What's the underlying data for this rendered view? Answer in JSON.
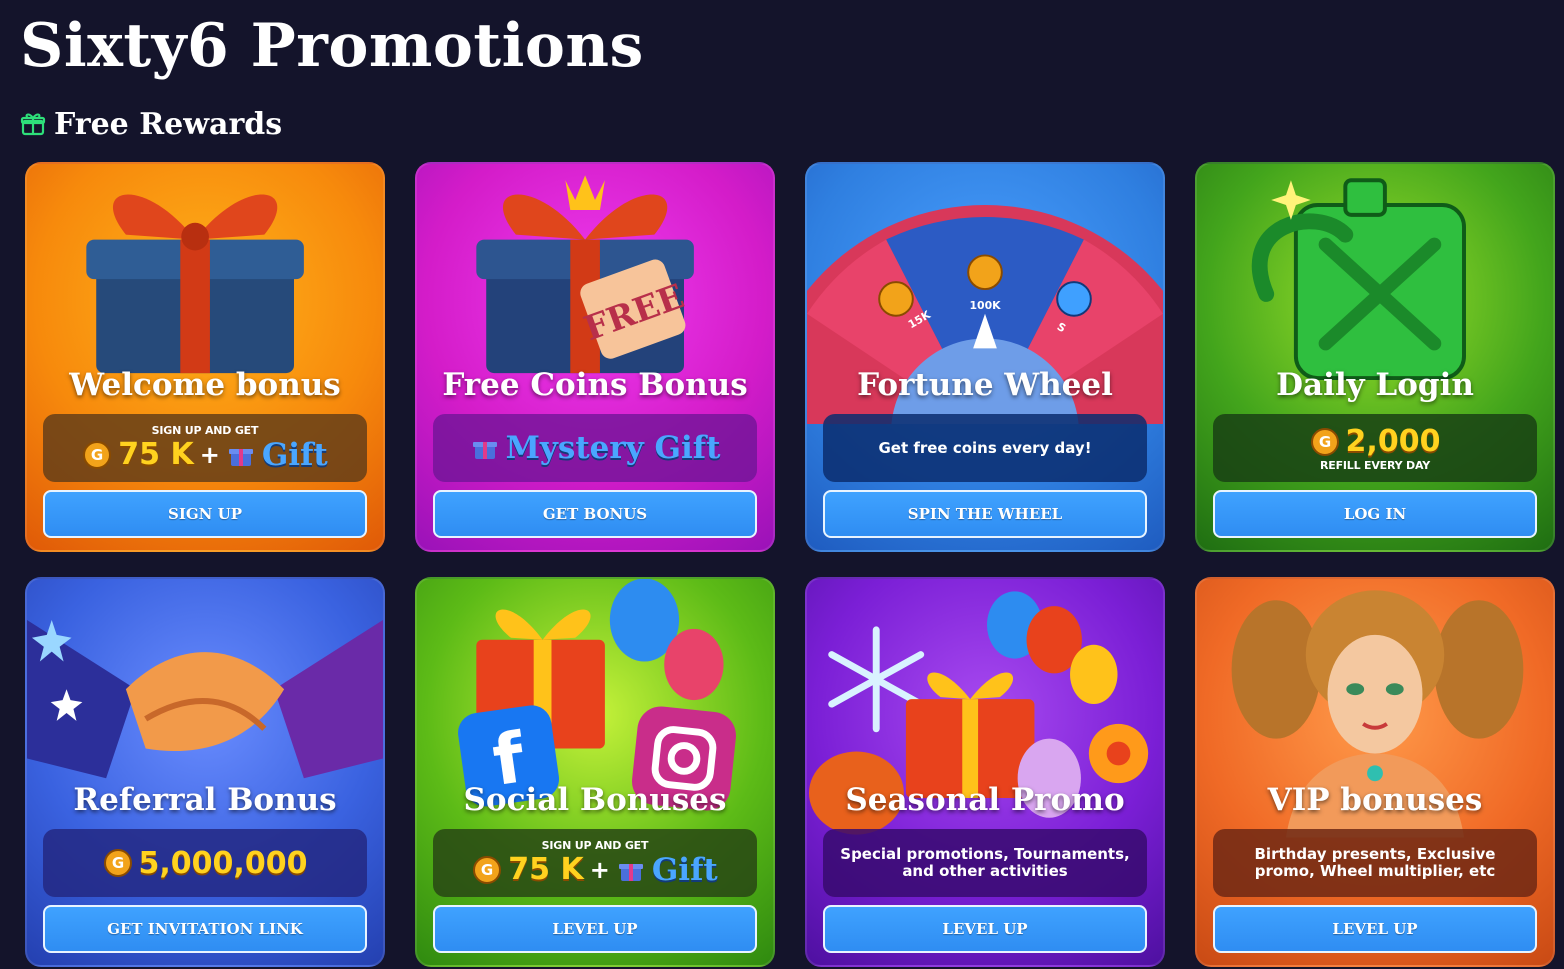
{
  "page": {
    "title": "Sixty6 Promotions",
    "section_title": "Free Rewards"
  },
  "cards": [
    {
      "id": "welcome",
      "title": "Welcome bonus",
      "caption": "SIGN UP AND GET",
      "amount": "75 K",
      "plus": "+",
      "gift": "Gift",
      "button": "SIGN UP",
      "bg": "#f78a0c"
    },
    {
      "id": "free-coins",
      "title": "Free Coins Bonus",
      "gift_label": "Mystery Gift",
      "button": "GET BONUS",
      "bg": "#d41cc9"
    },
    {
      "id": "fortune-wheel",
      "title": "Fortune Wheel",
      "text": "Get free coins every day!",
      "button": "SPIN THE WHEEL",
      "bg": "#2f7fe0",
      "wheel_labels": [
        "15K",
        "100K",
        "S"
      ]
    },
    {
      "id": "daily-login",
      "title": "Daily Login",
      "amount": "2,000",
      "caption": "REFILL EVERY DAY",
      "button": "LOG IN",
      "bg": "#43a51c"
    },
    {
      "id": "referral",
      "title": "Referral Bonus",
      "amount": "5,000,000",
      "button": "GET INVITATION LINK",
      "bg": "#3a62e0"
    },
    {
      "id": "social",
      "title": "Social Bonuses",
      "caption": "SIGN UP AND GET",
      "amount": "75 K",
      "plus": "+",
      "gift": "Gift",
      "button": "LEVEL UP",
      "bg": "#5dbb17"
    },
    {
      "id": "seasonal",
      "title": "Seasonal Promo",
      "text": "Special promotions, Tournaments, and other activities",
      "button": "LEVEL UP",
      "bg": "#7b1fd6"
    },
    {
      "id": "vip",
      "title": "VIP bonuses",
      "text": "Birthday presents, Exclusive promo, Wheel multiplier, etc",
      "button": "LEVEL UP",
      "bg": "#f06a26"
    }
  ]
}
